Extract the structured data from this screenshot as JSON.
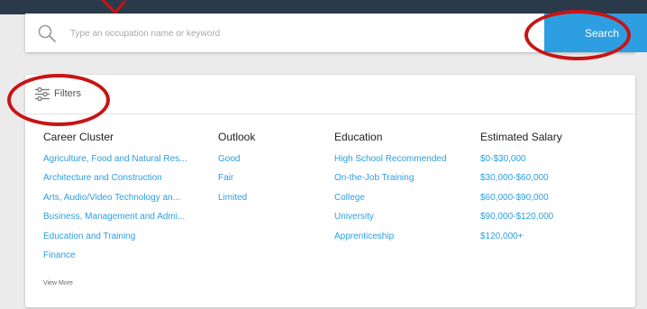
{
  "search": {
    "placeholder": "Type an occupation name or keyword",
    "button_label": "Search",
    "icon": "search-icon"
  },
  "filters": {
    "label": "Filters",
    "icon": "sliders-icon"
  },
  "columns": {
    "career": {
      "title": "Career Cluster",
      "items": [
        "Agriculture, Food and Natural Res...",
        "Architecture and Construction",
        "Arts, Audio/Video Technology an...",
        "Business, Management and Admi...",
        "Education and Training",
        "Finance"
      ],
      "view_more": "View More"
    },
    "outlook": {
      "title": "Outlook",
      "items": [
        "Good",
        "Fair",
        "Limited"
      ]
    },
    "education": {
      "title": "Education",
      "items": [
        "High School Recommended",
        "On-the-Job Training",
        "College",
        "University",
        "Apprenticeship"
      ]
    },
    "salary": {
      "title": "Estimated Salary",
      "items": [
        "$0-$30,000",
        "$30,000-$60,000",
        "$60,000-$90,000",
        "$90,000-$120,000",
        "$120,000+"
      ]
    }
  },
  "colors": {
    "accent": "#2d9ee0",
    "annotation": "#c81414",
    "header_band": "#2b3a4a"
  }
}
